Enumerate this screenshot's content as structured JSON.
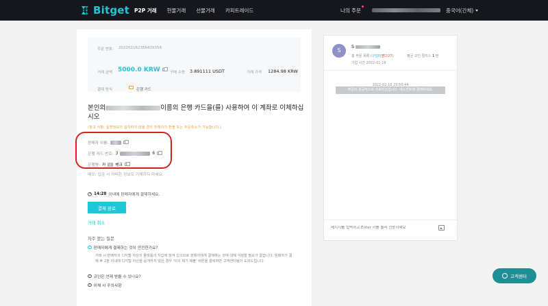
{
  "header": {
    "logo_text": "Bitget",
    "nav": [
      "P2P 거래",
      "현물거래",
      "선물거래",
      "카피트레이드"
    ],
    "my_orders": "나의 주문",
    "language": "중국어(간체)"
  },
  "order": {
    "order_no_label": "주문 번호:",
    "order_no": "202202162356439358",
    "amount_label": "거래 금액",
    "amount_value": "5000.0 KRW",
    "qty_label": "구매 수량",
    "qty_value": "3.891111 USDT",
    "price_label": "거래 가격",
    "price_value": "1284.98 KRW",
    "payment_label": "결제 방식",
    "payment_value": "은행 카드"
  },
  "instruction": {
    "title_prefix": "본인의",
    "title_suffix": "이름의 은행 카드을(를) 사용하여 이 계좌로 이체하십시오",
    "notice": "(참고 사항: 실명정보가 일치하지 않을 경우 판매자가 환불 또는 주문취소가 가능합니다.)",
    "seller_name_label": "판매자 이름:",
    "card_no_label": "은행 카드 번호:",
    "card_no_prefix": "3",
    "card_no_suffix": "6",
    "bank_label": "은행명:",
    "bank_prefix": "카",
    "bank_suffix": "뱅크",
    "memo": "메모: 입금 시 어떠한 정보도 기재하지 마세요."
  },
  "countdown": {
    "time": "14:28",
    "text": "이내에 판매자에게 결제하세요."
  },
  "actions": {
    "pay_done": "결제 완료",
    "cancel": "거래 취소"
  },
  "faq": {
    "title": "자주 묻는 질문",
    "q1": "판매자에게 결제하는 것이 안전한가요?",
    "a1": "거래 시 판매자의 디지털 자산이 플랫폼의 지갑에 잠겨 있으므로 판매자에게 결제하는 것에 대해 걱정할 필요가 없습니다. 판매자가 결제 후 2분 이내에 디지털 자산을 공개하지 않은 경우 '이의 제기 제출' 버튼을 클릭하면 고객센터팀이 도와드립니다.",
    "q2": "코인은 언제 받을 수 있나요?",
    "q3": "이체 시 주의사항"
  },
  "chat": {
    "avatar_letter": "S",
    "name_initial": "S",
    "stats_prefix": "총 주문 목록 (",
    "stats_buy": "구입0",
    "stats_sep": "|",
    "stats_sell": "팔다27",
    "stats_suffix": ")",
    "release_label": "평균 코인 릴리스",
    "release_value": "1",
    "release_unit": "분",
    "join_label": "가입 시간",
    "join_value": "2022-01-16",
    "timestamp": "2022-02-16 23:50:44",
    "system_message": "주문이 성공적으로 완료되었습니다. 에스컨트에 결제하세요.",
    "input_placeholder": "메시지를 입력하고 Enter 키를 눌러 전송하세요"
  },
  "support": {
    "label": "고객센터"
  },
  "colors": {
    "accent": "#1ec6d6",
    "header_bg": "#15171c",
    "highlight_ring": "#d7201d"
  }
}
